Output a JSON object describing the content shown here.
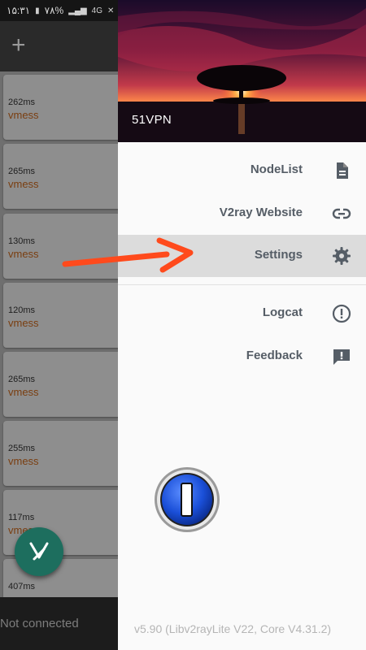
{
  "status_bar": {
    "time": "۱۵:۳۱",
    "battery": "۷۸%",
    "network": "4G"
  },
  "app": {
    "add_label": "+",
    "servers": [
      {
        "latency": "262ms",
        "protocol": "vmess"
      },
      {
        "latency": "265ms",
        "protocol": "vmess"
      },
      {
        "latency": "130ms",
        "protocol": "vmess"
      },
      {
        "latency": "120ms",
        "protocol": "vmess"
      },
      {
        "latency": "265ms",
        "protocol": "vmess"
      },
      {
        "latency": "255ms",
        "protocol": "vmess"
      },
      {
        "latency": "117ms",
        "protocol": "vmess"
      },
      {
        "latency": "407ms",
        "protocol": ""
      }
    ],
    "connection_status": "Not connected"
  },
  "drawer": {
    "header_title": "51VPN",
    "items": [
      {
        "label": "NodeList",
        "icon": "document-icon"
      },
      {
        "label": "V2ray Website",
        "icon": "link-icon"
      },
      {
        "label": "Settings",
        "icon": "gear-icon"
      },
      {
        "label": "Logcat",
        "icon": "alert-circle-icon"
      },
      {
        "label": "Feedback",
        "icon": "feedback-icon"
      }
    ],
    "version": "v5.90 (Libv2rayLite V22, Core V4.31.2)"
  },
  "colors": {
    "accent_arrow": "#ff4a1c",
    "fab": "#1d6e5e",
    "protocol_text": "#7a3e10",
    "selected_row": "#dcdcdc"
  }
}
